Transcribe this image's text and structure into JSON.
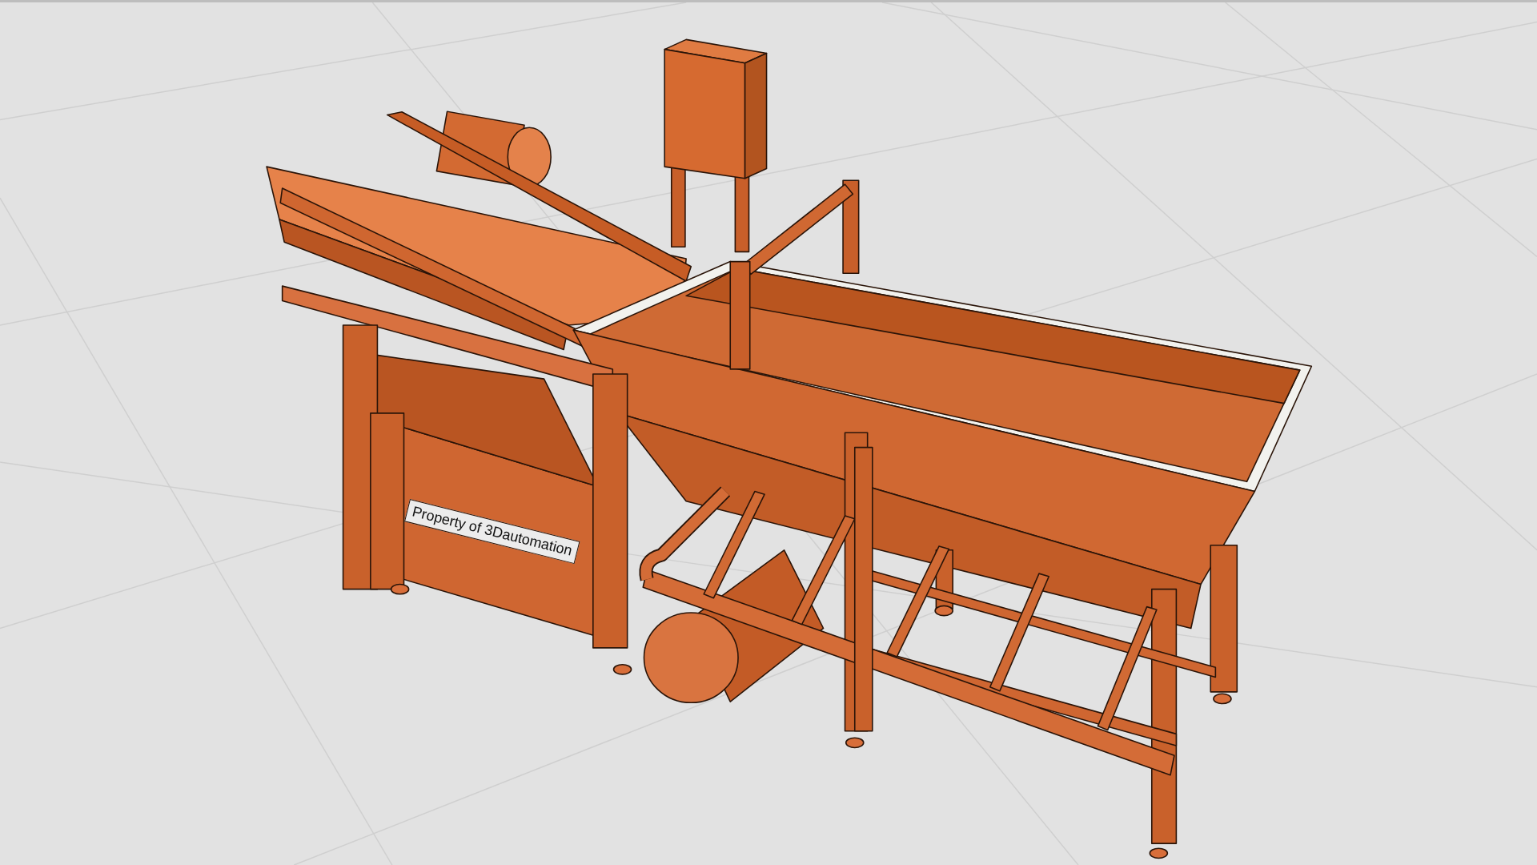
{
  "viewport": {
    "model_label": "Property of 3Dautomation"
  }
}
